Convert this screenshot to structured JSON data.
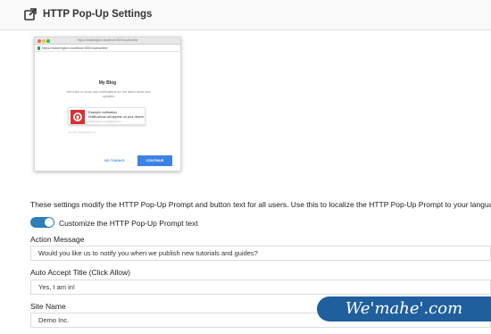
{
  "header": {
    "title": "HTTP Pop-Up Settings",
    "icon": "external-link-icon"
  },
  "preview": {
    "window_title": "https://washington.localhost:3001/subscribe",
    "url": "https://washington.localhost:3001/subscribe",
    "blog_title": "My Blog",
    "message": "We'd like to show you notifications for the latest news and updates",
    "card": {
      "line1": "Example notification",
      "line2": "Notifications will appear on your device",
      "line3": "washington.onesignal.com"
    },
    "subdomain": "yoursite.onesignal.com",
    "no_thanks": "NO THANKS",
    "continue": "CONTINUE"
  },
  "description": "These settings modify the HTTP Pop-Up Prompt and button text for all users. Use this to localize the HTTP Pop-Up Prompt to your langua",
  "customize_toggle": {
    "label": "Customize the HTTP Pop-Up Prompt text",
    "enabled": true
  },
  "fields": {
    "action_message": {
      "label": "Action Message",
      "value": "Would you like us to notify you when we publish new tutorials and guides?"
    },
    "auto_accept_title": {
      "label": "Auto Accept Title (Click Allow)",
      "value": "Yes, I am in!"
    },
    "site_name": {
      "label": "Site Name",
      "value": "Demo Inc."
    }
  },
  "watermark": "We'mahe'.com",
  "colors": {
    "toggle_on": "#2d7fb8",
    "continue_button": "#3b82e6",
    "card_icon": "#d9302f",
    "watermark_bg": "#1f5f9e"
  }
}
